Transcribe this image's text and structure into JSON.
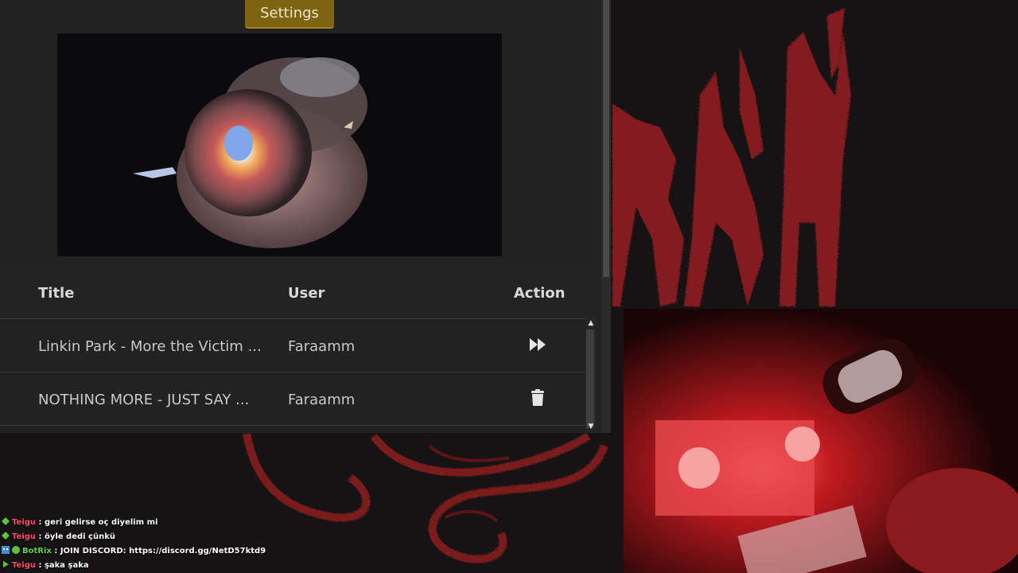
{
  "settings": {
    "label": "Settings"
  },
  "table": {
    "headers": {
      "title": "Title",
      "user": "User",
      "action": "Action"
    },
    "rows": [
      {
        "title": "Linkin Park - More the Victim ...",
        "user": "Faraamm",
        "action_icon": "fast-forward-icon"
      },
      {
        "title": "NOTHING MORE - JUST SAY ...",
        "user": "Faraamm",
        "action_icon": "trash-icon"
      }
    ]
  },
  "background_text": "RAH",
  "chat": [
    {
      "badge": "diamond-icon",
      "badge_color": "#5ec33a",
      "user": "Teigu",
      "user_color": "#ff4d6d",
      "separator": " : ",
      "message": "geri gelirse oç diyelim mi"
    },
    {
      "badge": "diamond-icon",
      "badge_color": "#5ec33a",
      "user": "Teigu",
      "user_color": "#ff4d6d",
      "separator": " : ",
      "message": "öyle dedi çünkü"
    },
    {
      "badge": "bot-icon",
      "badge_color": "#3d8fd6",
      "user": "BotRix",
      "user_color": "#69d04a",
      "separator": " : ",
      "message": "JOIN DISCORD: https://discord.gg/NetD57ktd9"
    },
    {
      "badge": "arrow-icon",
      "badge_color": "#5ec33a",
      "user": "Teigu",
      "user_color": "#ff4d6d",
      "separator": " : ",
      "message": "şaka şaka"
    }
  ],
  "colors": {
    "accent": "#7d6412",
    "panel": "#222222",
    "art_red": "#8a1f22"
  }
}
